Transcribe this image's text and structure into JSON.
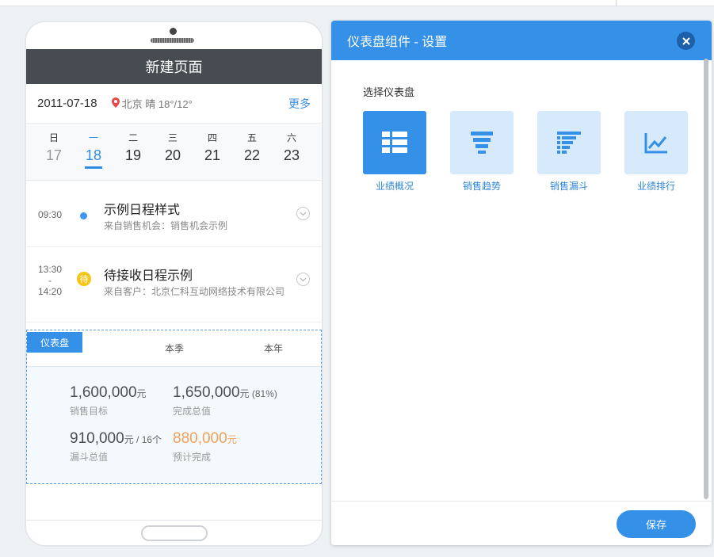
{
  "phone": {
    "header_title": "新建页面",
    "date": "2011-07-18",
    "location": "北京",
    "weather": "晴 18°/12°",
    "more_label": "更多",
    "week": [
      {
        "dow": "日",
        "num": "17"
      },
      {
        "dow": "一",
        "num": "18"
      },
      {
        "dow": "二",
        "num": "19"
      },
      {
        "dow": "三",
        "num": "20"
      },
      {
        "dow": "四",
        "num": "21"
      },
      {
        "dow": "五",
        "num": "22"
      },
      {
        "dow": "六",
        "num": "23"
      }
    ],
    "events": [
      {
        "time_start": "09:30",
        "time_sep": "",
        "time_end": "",
        "title": "示例日程样式",
        "subtitle": "来自销售机会：销售机会示例"
      },
      {
        "time_start": "13:30",
        "time_sep": "-",
        "time_end": "14:20",
        "badge": "待",
        "title": "待接收日程示例",
        "subtitle": "来自客户：北京仁科互动网络技术有限公司"
      }
    ],
    "dashboard": {
      "tag": "仪表盘",
      "tabs": [
        "本季",
        "本年"
      ],
      "stats": [
        {
          "value": "1,600,000",
          "unit": "元",
          "extra": "",
          "label": "销售目标"
        },
        {
          "value": "1,650,000",
          "unit": "元",
          "extra": " (81%)",
          "label": "完成总值"
        },
        {
          "value": "910,000",
          "unit": "元 / 16个",
          "extra": "",
          "label": "漏斗总值"
        },
        {
          "value": "880,000",
          "unit": "元",
          "extra": "",
          "label": "预计完成"
        }
      ]
    }
  },
  "dialog": {
    "title": "仪表盘组件 - 设置",
    "close_icon": "close-icon",
    "select_label": "选择仪表盘",
    "options": [
      {
        "label": "业绩概况",
        "icon": "grid-icon",
        "active": true
      },
      {
        "label": "销售趋势",
        "icon": "funnel-icon",
        "active": false
      },
      {
        "label": "销售漏斗",
        "icon": "funnel-bars-icon",
        "active": false
      },
      {
        "label": "业绩排行",
        "icon": "line-chart-icon",
        "active": false
      }
    ],
    "save_label": "保存"
  },
  "colors": {
    "accent": "#3590e8",
    "header_dark": "#474c52",
    "orange": "#f0a05a",
    "tile_inactive": "#d6eafc"
  }
}
